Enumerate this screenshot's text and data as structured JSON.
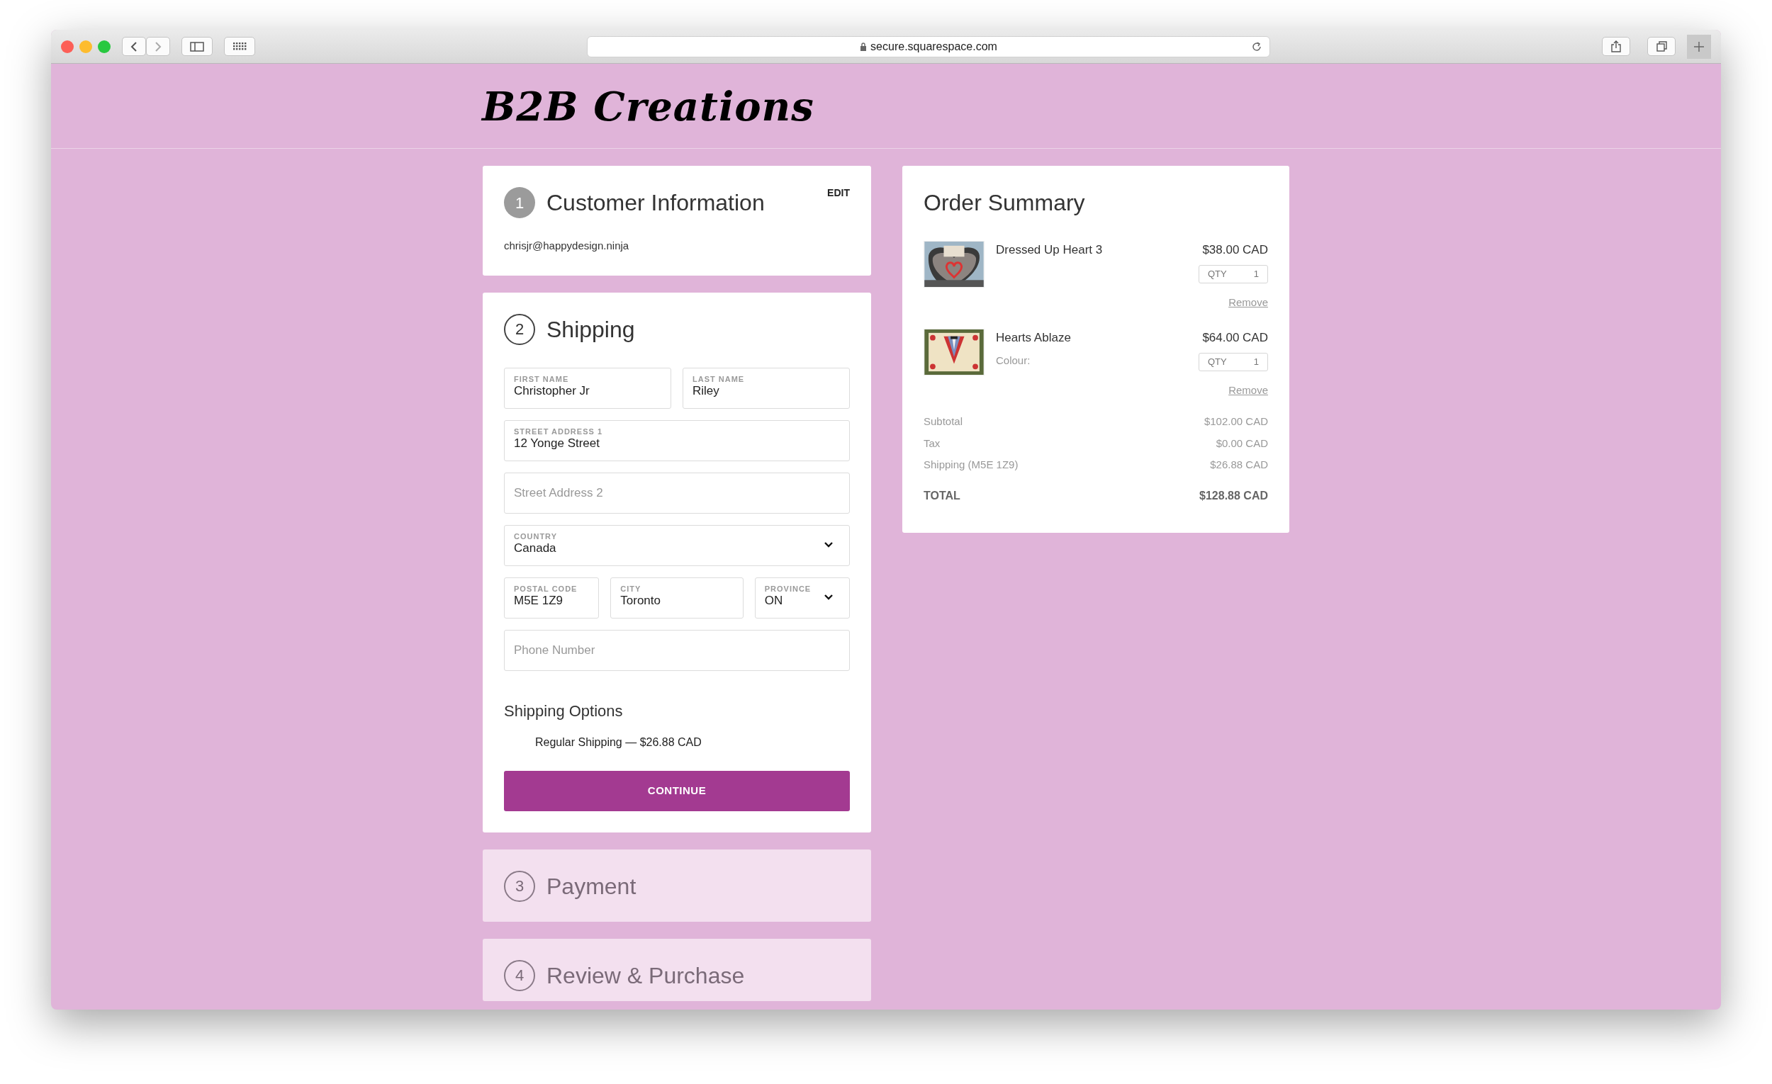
{
  "browser": {
    "url": "secure.squarespace.com"
  },
  "logo": "B2B Creations",
  "steps": [
    {
      "number": "1",
      "title": "Customer Information",
      "done": true,
      "active": false,
      "action": "EDIT",
      "summary": "chrisjr@happydesign.ninja"
    },
    {
      "number": "2",
      "title": "Shipping",
      "done": false,
      "active": true
    },
    {
      "number": "3",
      "title": "Payment",
      "done": false,
      "active": false
    },
    {
      "number": "4",
      "title": "Review & Purchase",
      "done": false,
      "active": false
    }
  ],
  "shipping_form": {
    "rows": [
      [
        {
          "kind": "text",
          "label": "FIRST NAME",
          "value": "Christopher Jr"
        },
        {
          "kind": "text",
          "label": "LAST NAME",
          "value": "Riley"
        }
      ],
      [
        {
          "kind": "text",
          "label": "STREET ADDRESS 1",
          "value": "12 Yonge Street"
        }
      ],
      [
        {
          "kind": "text",
          "placeholder": "Street Address 2"
        }
      ],
      [
        {
          "kind": "select",
          "label": "COUNTRY",
          "value": "Canada"
        }
      ],
      [
        {
          "kind": "text",
          "label": "POSTAL CODE",
          "value": "M5E 1Z9"
        },
        {
          "kind": "text",
          "label": "CITY",
          "value": "Toronto"
        },
        {
          "kind": "select",
          "label": "PROVINCE",
          "value": "ON"
        }
      ],
      [
        {
          "kind": "text",
          "placeholder": "Phone Number"
        }
      ]
    ],
    "options_title": "Shipping Options",
    "options": [
      {
        "label": "Regular Shipping — $26.88 CAD"
      }
    ],
    "button": "CONTINUE"
  },
  "order_summary": {
    "title": "Order Summary",
    "items": [
      {
        "name": "Dressed Up Heart 3",
        "price": "$38.00 CAD",
        "qty_label": "QTY",
        "qty": "1",
        "remove": "Remove"
      },
      {
        "name": "Hearts Ablaze",
        "detail": "Colour:",
        "price": "$64.00 CAD",
        "qty_label": "QTY",
        "qty": "1",
        "remove": "Remove"
      }
    ],
    "lines": [
      {
        "label": "Subtotal",
        "value": "$102.00 CAD"
      },
      {
        "label": "Tax",
        "value": "$0.00 CAD"
      },
      {
        "label": "Shipping (M5E 1Z9)",
        "value": "$26.88 CAD"
      }
    ],
    "total": {
      "label": "TOTAL",
      "value": "$128.88 CAD"
    }
  }
}
